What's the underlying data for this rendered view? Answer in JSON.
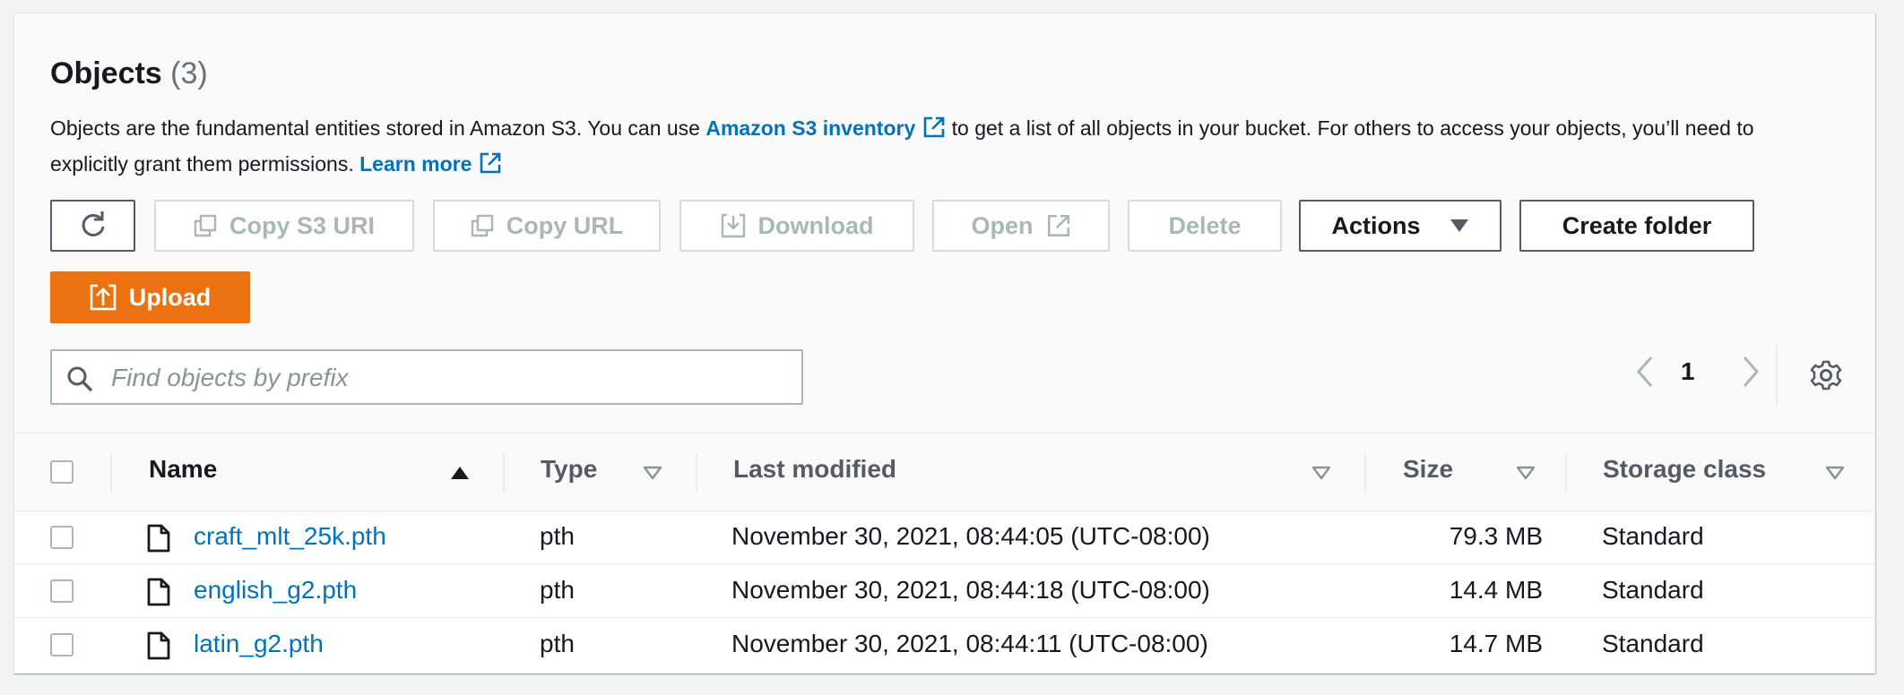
{
  "header": {
    "title": "Objects",
    "count": "(3)",
    "desc_part1": "Objects are the fundamental entities stored in Amazon S3. You can use",
    "inventory_link": "Amazon S3 inventory",
    "desc_part2": "to get a list of all objects in your bucket. For others to access your objects, you’ll need to explicitly grant them permissions.",
    "learn_more": "Learn more"
  },
  "toolbar": {
    "copy_s3_uri": "Copy S3 URI",
    "copy_url": "Copy URL",
    "download": "Download",
    "open": "Open",
    "delete": "Delete",
    "actions": "Actions",
    "create_folder": "Create folder",
    "upload": "Upload"
  },
  "search": {
    "placeholder": "Find objects by prefix"
  },
  "pagination": {
    "page": "1"
  },
  "table": {
    "columns": [
      "Name",
      "Type",
      "Last modified",
      "Size",
      "Storage class"
    ],
    "rows": [
      {
        "name": "craft_mlt_25k.pth",
        "type": "pth",
        "modified": "November 30, 2021, 08:44:05 (UTC-08:00)",
        "size": "79.3 MB",
        "storage": "Standard"
      },
      {
        "name": "english_g2.pth",
        "type": "pth",
        "modified": "November 30, 2021, 08:44:18 (UTC-08:00)",
        "size": "14.4 MB",
        "storage": "Standard"
      },
      {
        "name": "latin_g2.pth",
        "type": "pth",
        "modified": "November 30, 2021, 08:44:11 (UTC-08:00)",
        "size": "14.7 MB",
        "storage": "Standard"
      }
    ]
  },
  "colors": {
    "link": "#0073bb",
    "primary": "#ec7211",
    "disabled": "#aab7b8"
  },
  "icons": [
    "refresh-icon",
    "copy-icon",
    "download-icon",
    "external-link-icon",
    "caret-down-icon",
    "upload-icon",
    "search-icon",
    "chevron-left-icon",
    "chevron-right-icon",
    "gear-icon",
    "sort-ascending-icon",
    "sort-icon",
    "file-icon"
  ]
}
